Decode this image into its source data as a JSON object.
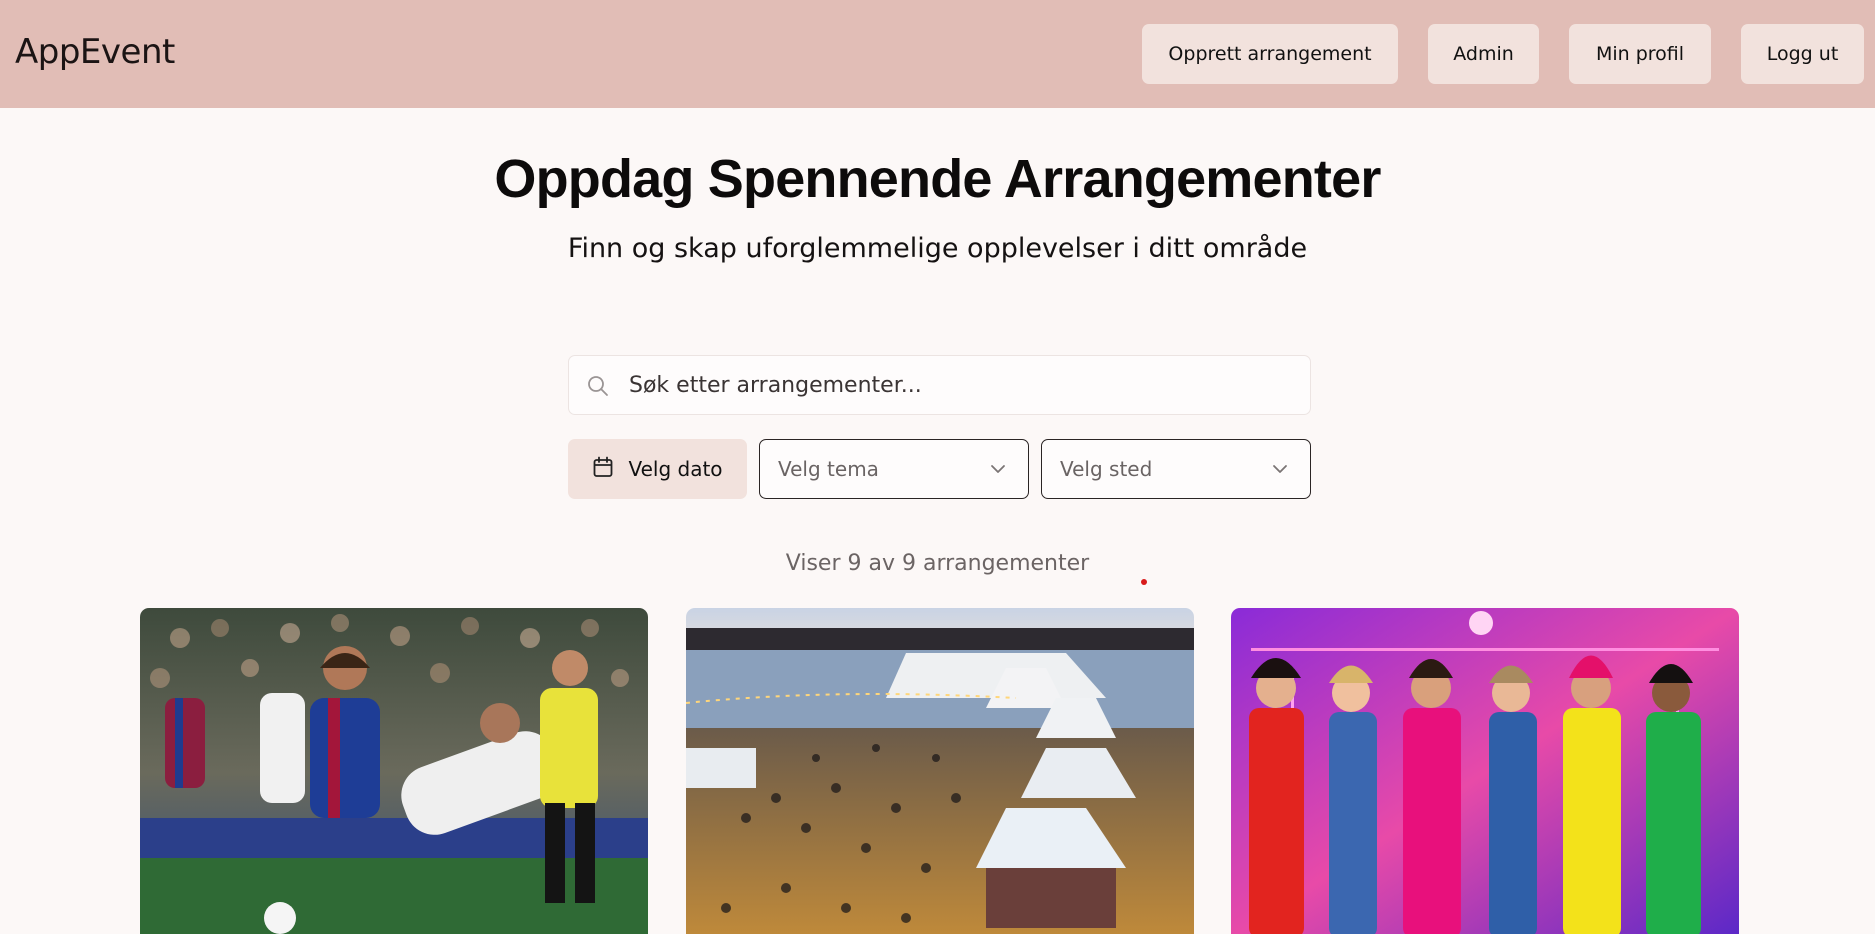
{
  "header": {
    "logo": "AppEvent",
    "nav": {
      "create": "Opprett arrangement",
      "admin": "Admin",
      "profile": "Min profil",
      "logout": "Logg ut"
    }
  },
  "hero": {
    "title": "Oppdag Spennende Arrangementer",
    "subtitle": "Finn og skap uforglemmelige opplevelser i ditt område"
  },
  "search": {
    "placeholder": "Søk etter arrangementer...",
    "value": ""
  },
  "filters": {
    "date_label": "Velg dato",
    "theme_placeholder": "Velg tema",
    "place_placeholder": "Velg sted"
  },
  "results": {
    "count_text": "Viser 9 av 9 arrangementer"
  },
  "events": [
    {
      "image": "football-match-photo"
    },
    {
      "image": "waterfront-night-market-photo"
    },
    {
      "image": "retro-party-group-photo"
    }
  ],
  "colors": {
    "header_bg": "#e1bdb6",
    "button_bg": "#f2e2dd",
    "page_bg": "#fcf8f7"
  }
}
